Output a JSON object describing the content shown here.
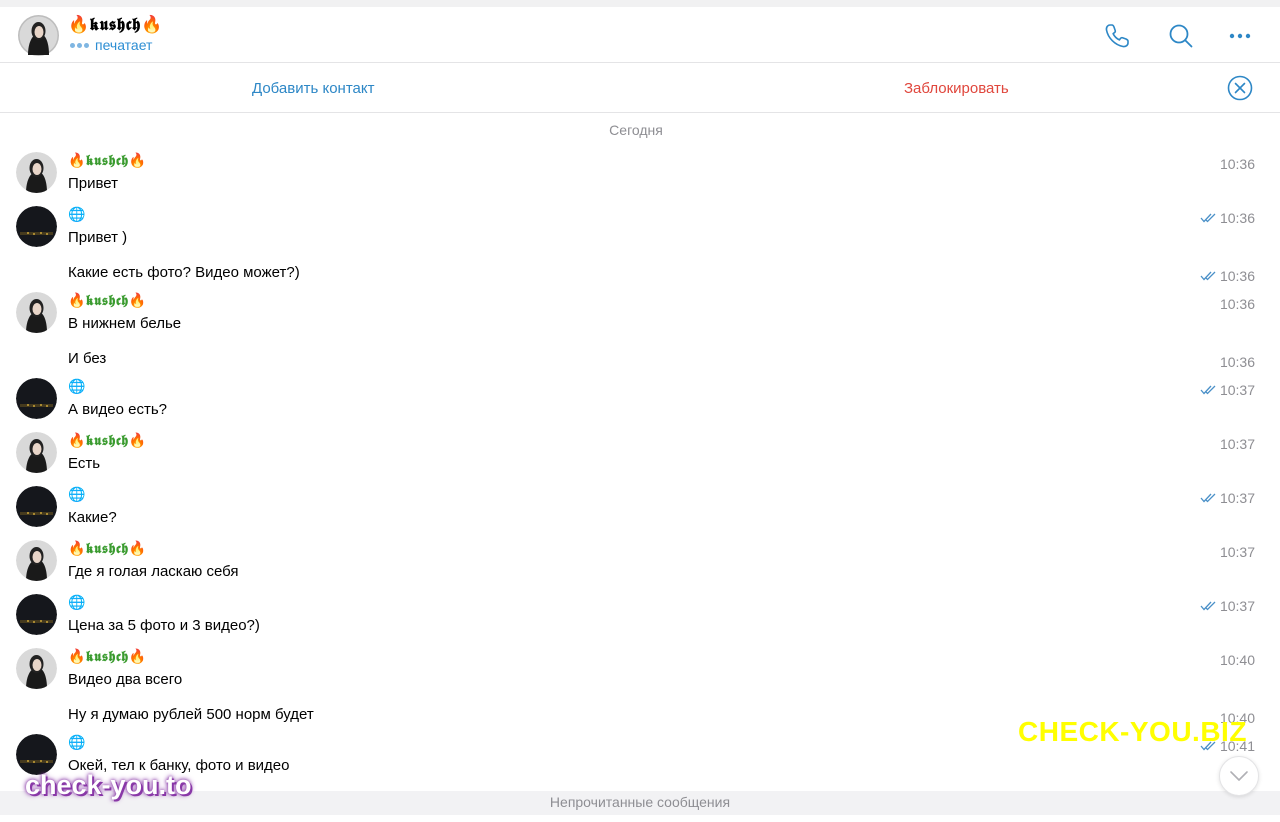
{
  "chat": {
    "title": "🔥𝖐𝖚𝖘𝖍𝖈𝖍🔥",
    "status": "печатает"
  },
  "actions": {
    "add_contact": "Добавить контакт",
    "block": "Заблокировать"
  },
  "date_separator": "Сегодня",
  "messages": [
    {
      "sender": "🔥𝖐𝖚𝖘𝖍𝖈𝖍🔥",
      "text": "Привет",
      "time": "10:36",
      "outgoing": false
    },
    {
      "sender": "🌐",
      "text": "Привет )",
      "time": "10:36",
      "outgoing": true
    },
    {
      "sender": "",
      "text": "Какие есть фото? Видео может?)",
      "time": "10:36",
      "outgoing": true
    },
    {
      "sender": "🔥𝖐𝖚𝖘𝖍𝖈𝖍🔥",
      "text": "В нижнем белье",
      "time": "10:36",
      "outgoing": false
    },
    {
      "sender": "",
      "text": "И без",
      "time": "10:36",
      "outgoing": false
    },
    {
      "sender": "🌐",
      "text": "А видео есть?",
      "time": "10:37",
      "outgoing": true
    },
    {
      "sender": "🔥𝖐𝖚𝖘𝖍𝖈𝖍🔥",
      "text": "Есть",
      "time": "10:37",
      "outgoing": false
    },
    {
      "sender": "🌐",
      "text": "Какие?",
      "time": "10:37",
      "outgoing": true
    },
    {
      "sender": "🔥𝖐𝖚𝖘𝖍𝖈𝖍🔥",
      "text": "Где я голая ласкаю себя",
      "time": "10:37",
      "outgoing": false
    },
    {
      "sender": "🌐",
      "text": "Цена за 5 фото и 3 видео?)",
      "time": "10:37",
      "outgoing": true
    },
    {
      "sender": "🔥𝖐𝖚𝖘𝖍𝖈𝖍🔥",
      "text": "Видео два всего",
      "time": "10:40",
      "outgoing": false
    },
    {
      "sender": "",
      "text": "Ну я думаю рублей 500 норм будет",
      "time": "10:40",
      "outgoing": false
    },
    {
      "sender": "🌐",
      "text": "Окей, тел к банку, фото и видео",
      "time": "10:41",
      "outgoing": true
    }
  ],
  "unread_label": "Непрочитанные сообщения",
  "watermarks": {
    "right": "CHECK-YOU.BIZ",
    "left": "check-you.to"
  },
  "colors": {
    "accent": "#2d87c6",
    "danger": "#e0473d",
    "sender_name": "#3a9b2f",
    "muted": "#8e8e93"
  }
}
